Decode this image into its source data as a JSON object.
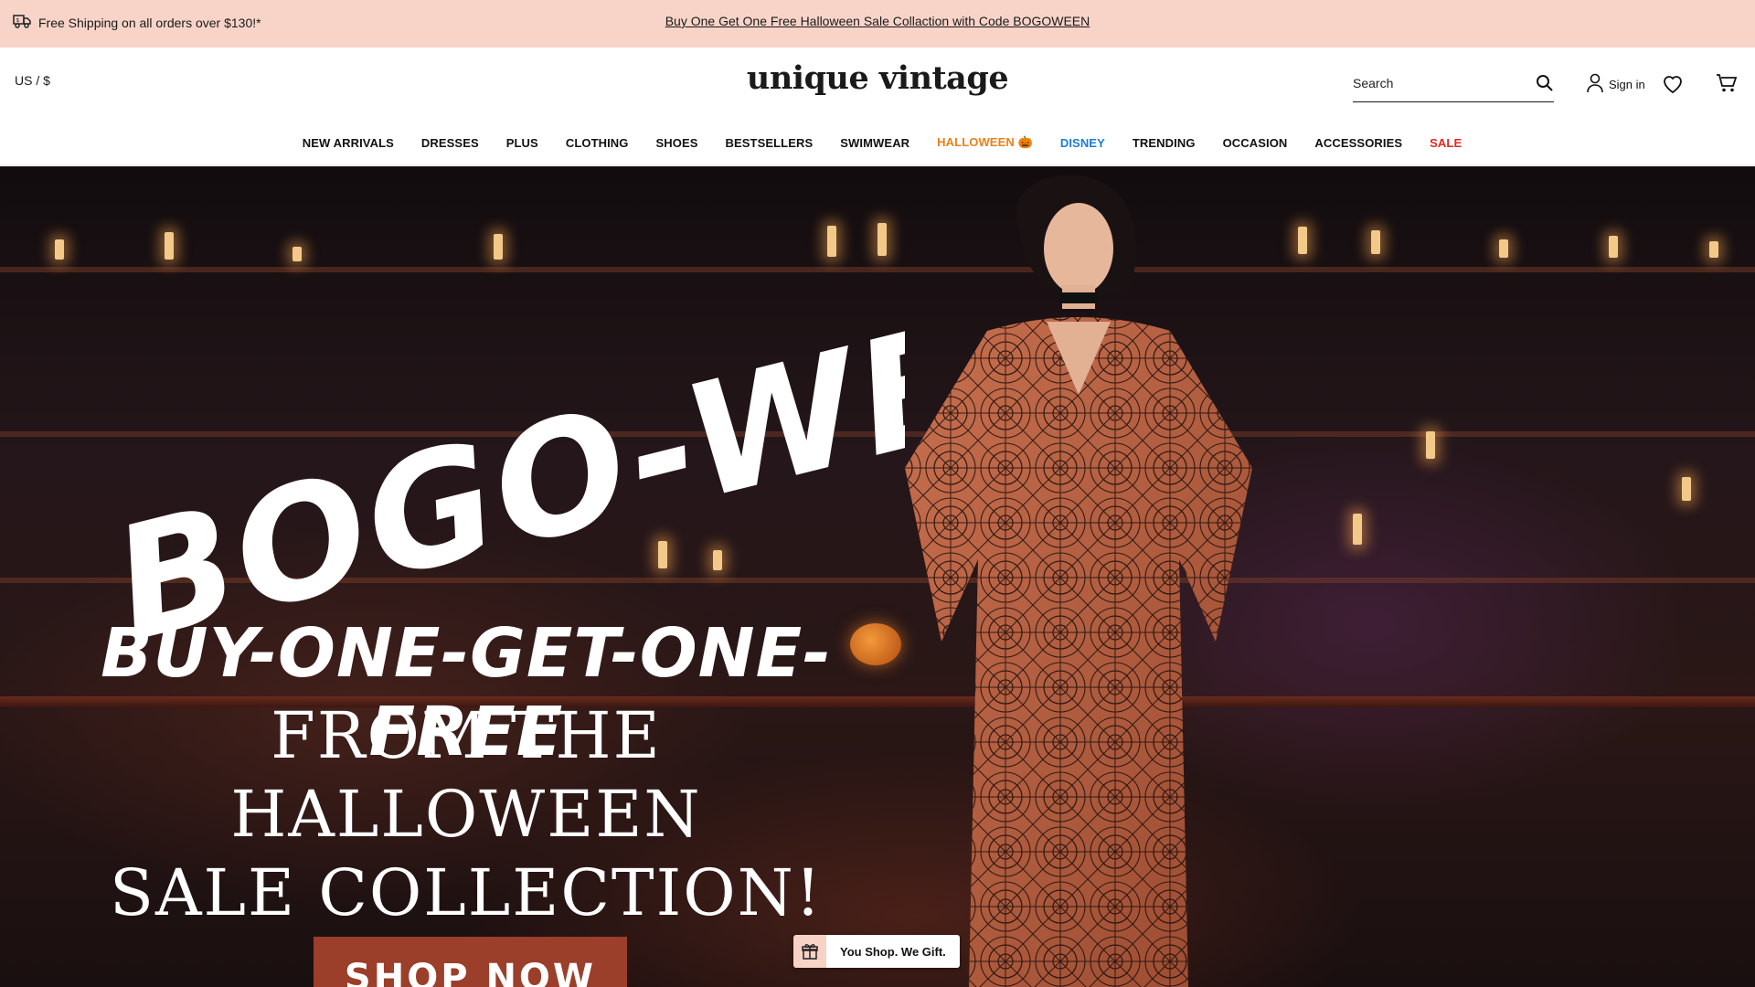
{
  "announcement": {
    "shipping_text": "Free Shipping on all orders over $130!*",
    "promo_link": "Buy One Get One Free Halloween Sale Collaction with Code BOGOWEEN"
  },
  "header": {
    "locale": "US / $",
    "logo": "unique vintage",
    "search_placeholder": "Search",
    "signin_label": "Sign in"
  },
  "nav": {
    "items": [
      {
        "label": "NEW ARRIVALS"
      },
      {
        "label": "DRESSES"
      },
      {
        "label": "PLUS"
      },
      {
        "label": "CLOTHING"
      },
      {
        "label": "SHOES"
      },
      {
        "label": "BESTSELLERS"
      },
      {
        "label": "SWIMWEAR"
      },
      {
        "label": "HALLOWEEN 🎃"
      },
      {
        "label": "DISNEY"
      },
      {
        "label": "TRENDING"
      },
      {
        "label": "OCCASION"
      },
      {
        "label": "ACCESSORIES"
      },
      {
        "label": "SALE"
      }
    ],
    "colors": {
      "halloween": "#e8811a",
      "disney": "#1c7bd6",
      "sale": "#e0281f"
    }
  },
  "hero": {
    "title": "BOGO-WEEN",
    "subtitle": "BUY-ONE-GET-ONE-FREE",
    "line1": "FROM THE HALLOWEEN",
    "line2": "SALE COLLECTION!",
    "cta": "SHOP NOW",
    "cta_color": "#9b3e2a"
  },
  "gift_widget": {
    "label": "You Shop. We Gift.",
    "icon": "gift-icon"
  },
  "colors": {
    "announcement_bg": "#f8d4c8"
  }
}
